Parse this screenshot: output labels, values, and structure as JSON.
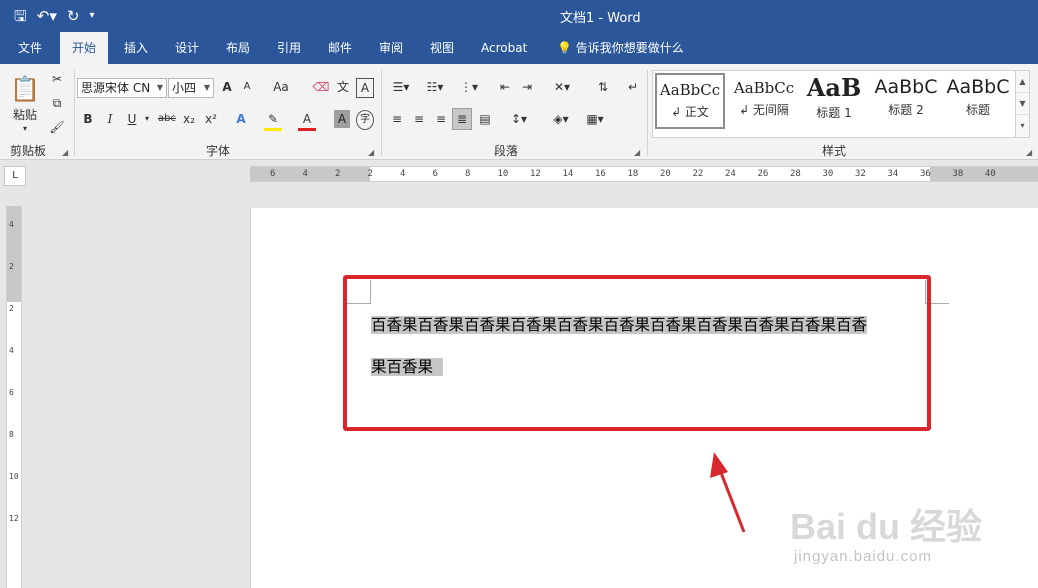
{
  "window": {
    "title": "文档1  -  Word"
  },
  "qat": {
    "save_icon": "save-icon",
    "undo_icon": "undo-icon",
    "redo_icon": "redo-icon",
    "customize_icon": "customize-qat-icon"
  },
  "tabs": [
    {
      "label": "文件"
    },
    {
      "label": "开始"
    },
    {
      "label": "插入"
    },
    {
      "label": "设计"
    },
    {
      "label": "布局"
    },
    {
      "label": "引用"
    },
    {
      "label": "邮件"
    },
    {
      "label": "审阅"
    },
    {
      "label": "视图"
    },
    {
      "label": "Acrobat"
    },
    {
      "label": "告诉我你想要做什么"
    }
  ],
  "clipboard": {
    "paste_label": "粘贴",
    "group_label": "剪贴板"
  },
  "font": {
    "name": "思源宋体 CN",
    "size": "小四",
    "group_label": "字体",
    "grow": "A",
    "shrink": "A",
    "case": "Aa",
    "pinyin": "文",
    "border_char": "A",
    "bold": "B",
    "italic": "I",
    "underline": "U",
    "strike": "abc",
    "sub": "x₂",
    "sup": "x²",
    "effects": "A",
    "color_a": "A",
    "shade_a": "A",
    "enclose": "字"
  },
  "paragraph": {
    "group_label": "段落"
  },
  "styles": {
    "group_label": "样式",
    "items": [
      {
        "sample": "AaBbCc",
        "name": "↲ 正文"
      },
      {
        "sample": "AaBbCc",
        "name": "↲ 无间隔"
      },
      {
        "sample": "AaB",
        "name": "标题 1"
      },
      {
        "sample": "AaBbC",
        "name": "标题 2"
      },
      {
        "sample": "AaBbC",
        "name": "标题"
      }
    ]
  },
  "ruler": {
    "corner": "L",
    "ticks": [
      "6",
      "4",
      "2",
      "2",
      "4",
      "6",
      "8",
      "10",
      "12",
      "14",
      "16",
      "18",
      "20",
      "22",
      "24",
      "26",
      "28",
      "30",
      "32",
      "34",
      "36",
      "38",
      "40"
    ],
    "vticks": [
      "4",
      "2",
      "2",
      "4",
      "6",
      "8",
      "10",
      "12"
    ]
  },
  "document": {
    "line1": "百香果百香果百香果百香果百香果百香果百香果百香果百香果百香果百香",
    "line2": "果百香果"
  },
  "watermark": {
    "main": "Bai du 经验",
    "sub": "jingyan.baidu.com"
  },
  "colors": {
    "accent": "#2b579a",
    "annotation": "#d8272d",
    "highlight": "#c6c6c6"
  }
}
